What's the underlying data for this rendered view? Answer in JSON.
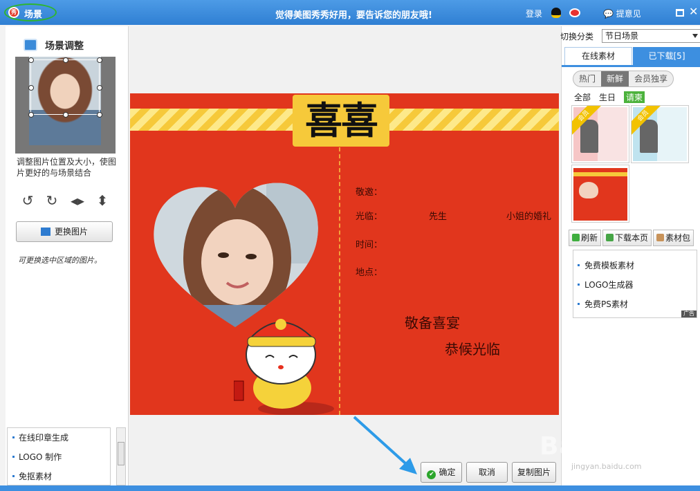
{
  "titlebar": {
    "title": "场景",
    "slogan": "觉得美图秀秀好用，要告诉您的朋友哦!",
    "login": "登录",
    "feedback": "提意见",
    "logo_text": "秀"
  },
  "left_panel": {
    "heading": "场景调整",
    "description": "调整图片位置及大小，使图片更好的与场景结合",
    "replace_button": "更换图片",
    "hint": "可更换选中区域的图片。",
    "links": [
      "在线印章生成",
      "LOGO 制作",
      "免抠素材"
    ]
  },
  "card": {
    "title": "喜喜",
    "invite": "敬邀：",
    "attend": "光临：",
    "mr": "先生",
    "miss_wedding": "小姐的婚礼",
    "time": "时间：",
    "place": "地点：",
    "blessing1": "敬备喜宴",
    "blessing2": "恭候光临"
  },
  "buttons": {
    "ok": "确定",
    "cancel": "取消",
    "copy": "复制图片"
  },
  "right_panel": {
    "category_label": "切换分类",
    "category_value": "节日场景",
    "tab_online": "在线素材",
    "tab_downloaded": "已下载[5]",
    "pills": [
      {
        "label": "热门",
        "active": false
      },
      {
        "label": "新鲜",
        "active": true
      },
      {
        "label": "会员独享",
        "active": false
      }
    ],
    "subtabs": [
      "全部",
      "生日",
      "请柬"
    ],
    "ribbon": "会员",
    "tools": [
      "刷新",
      "下载本页",
      "素材包"
    ],
    "ads": [
      "免费模板素材",
      "LOGO生成器",
      "免费PS素材"
    ],
    "ad_tag": "广告"
  },
  "watermark": {
    "main": "Baidu经验",
    "sub": "jingyan.baidu.com"
  },
  "colors": {
    "titlebar": "#2f7fd3",
    "card_red": "#e1361d",
    "gold": "#f6c93a",
    "accent_blue": "#3d8fe0"
  }
}
